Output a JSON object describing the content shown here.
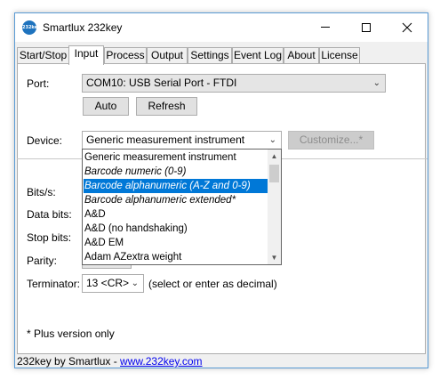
{
  "window": {
    "title": "Smartlux 232key",
    "app_icon_text": "232key"
  },
  "tabs": [
    {
      "label": "Start/Stop",
      "active": false
    },
    {
      "label": "Input",
      "active": true
    },
    {
      "label": "Process",
      "active": false
    },
    {
      "label": "Output",
      "active": false
    },
    {
      "label": "Settings",
      "active": false
    },
    {
      "label": "Event Log",
      "active": false
    },
    {
      "label": "About",
      "active": false
    },
    {
      "label": "License",
      "active": false
    }
  ],
  "port": {
    "label": "Port:",
    "value": "COM10: USB Serial Port - FTDI",
    "auto_label": "Auto",
    "refresh_label": "Refresh"
  },
  "device": {
    "label": "Device:",
    "value": "Generic measurement instrument",
    "customize_label": "Customize...*",
    "options": [
      {
        "text": "Generic measurement instrument",
        "italic": false,
        "selected": false
      },
      {
        "text": "Barcode numeric (0-9)",
        "italic": true,
        "selected": false
      },
      {
        "text": "Barcode alphanumeric (A-Z and 0-9)",
        "italic": true,
        "selected": true
      },
      {
        "text": "Barcode alphanumeric extended*",
        "italic": true,
        "selected": false
      },
      {
        "text": "A&D",
        "italic": false,
        "selected": false
      },
      {
        "text": "A&D (no handshaking)",
        "italic": false,
        "selected": false
      },
      {
        "text": "A&D EM",
        "italic": false,
        "selected": false
      },
      {
        "text": "Adam AZextra weight",
        "italic": false,
        "selected": false
      }
    ]
  },
  "params": {
    "bits_label": "Bits/s:",
    "data_bits_label": "Data bits:",
    "stop_bits_label": "Stop bits:",
    "parity_label": "Parity:"
  },
  "terminator": {
    "label": "Terminator:",
    "value": "13 <CR>",
    "hint": "(select or enter as decimal)"
  },
  "footnote": "* Plus version only",
  "status": {
    "text": "232key by Smartlux - ",
    "link": "www.232key.com"
  }
}
